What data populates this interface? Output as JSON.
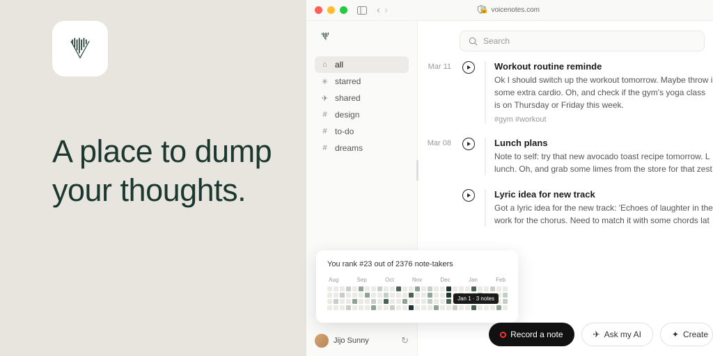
{
  "hero": "A place to dump your thoughts.",
  "url": "voicenotes.com",
  "search": {
    "placeholder": "Search"
  },
  "sidebar": {
    "items": [
      {
        "label": "all",
        "icon": "home",
        "active": true
      },
      {
        "label": "starred",
        "icon": "star"
      },
      {
        "label": "shared",
        "icon": "send"
      },
      {
        "label": "design",
        "icon": "hash"
      },
      {
        "label": "to-do",
        "icon": "hash"
      },
      {
        "label": "dreams",
        "icon": "hash"
      }
    ]
  },
  "notes": [
    {
      "date": "Mar 11",
      "title": "Workout routine reminde",
      "body": "Ok I should switch up the workout tomorrow. Maybe throw i some extra cardio. Oh, and check if the gym's yoga class is on Thursday or Friday this week.",
      "tags": "#gym  #workout"
    },
    {
      "date": "Mar 08",
      "title": "Lunch plans",
      "body": "Note to self: try that new avocado toast recipe tomorrow. L lunch. Oh, and grab some limes from the store for that zest"
    },
    {
      "date": "",
      "title": "Lyric idea for new track",
      "body": "Got a lyric idea for the new track: 'Echoes of laughter in the work for the chorus. Need to match it with some chords lat"
    }
  ],
  "rank": {
    "title": "You rank #23 out of 2376 note-takers",
    "months": [
      "Aug",
      "Sep",
      "Oct",
      "Nov",
      "Dec",
      "Jan",
      "Feb"
    ],
    "tooltip": "Jan 1 · 3 notes"
  },
  "user": {
    "name": "Jijo Sunny"
  },
  "actions": {
    "record": "Record a note",
    "ask": "Ask my AI",
    "create": "Create"
  }
}
